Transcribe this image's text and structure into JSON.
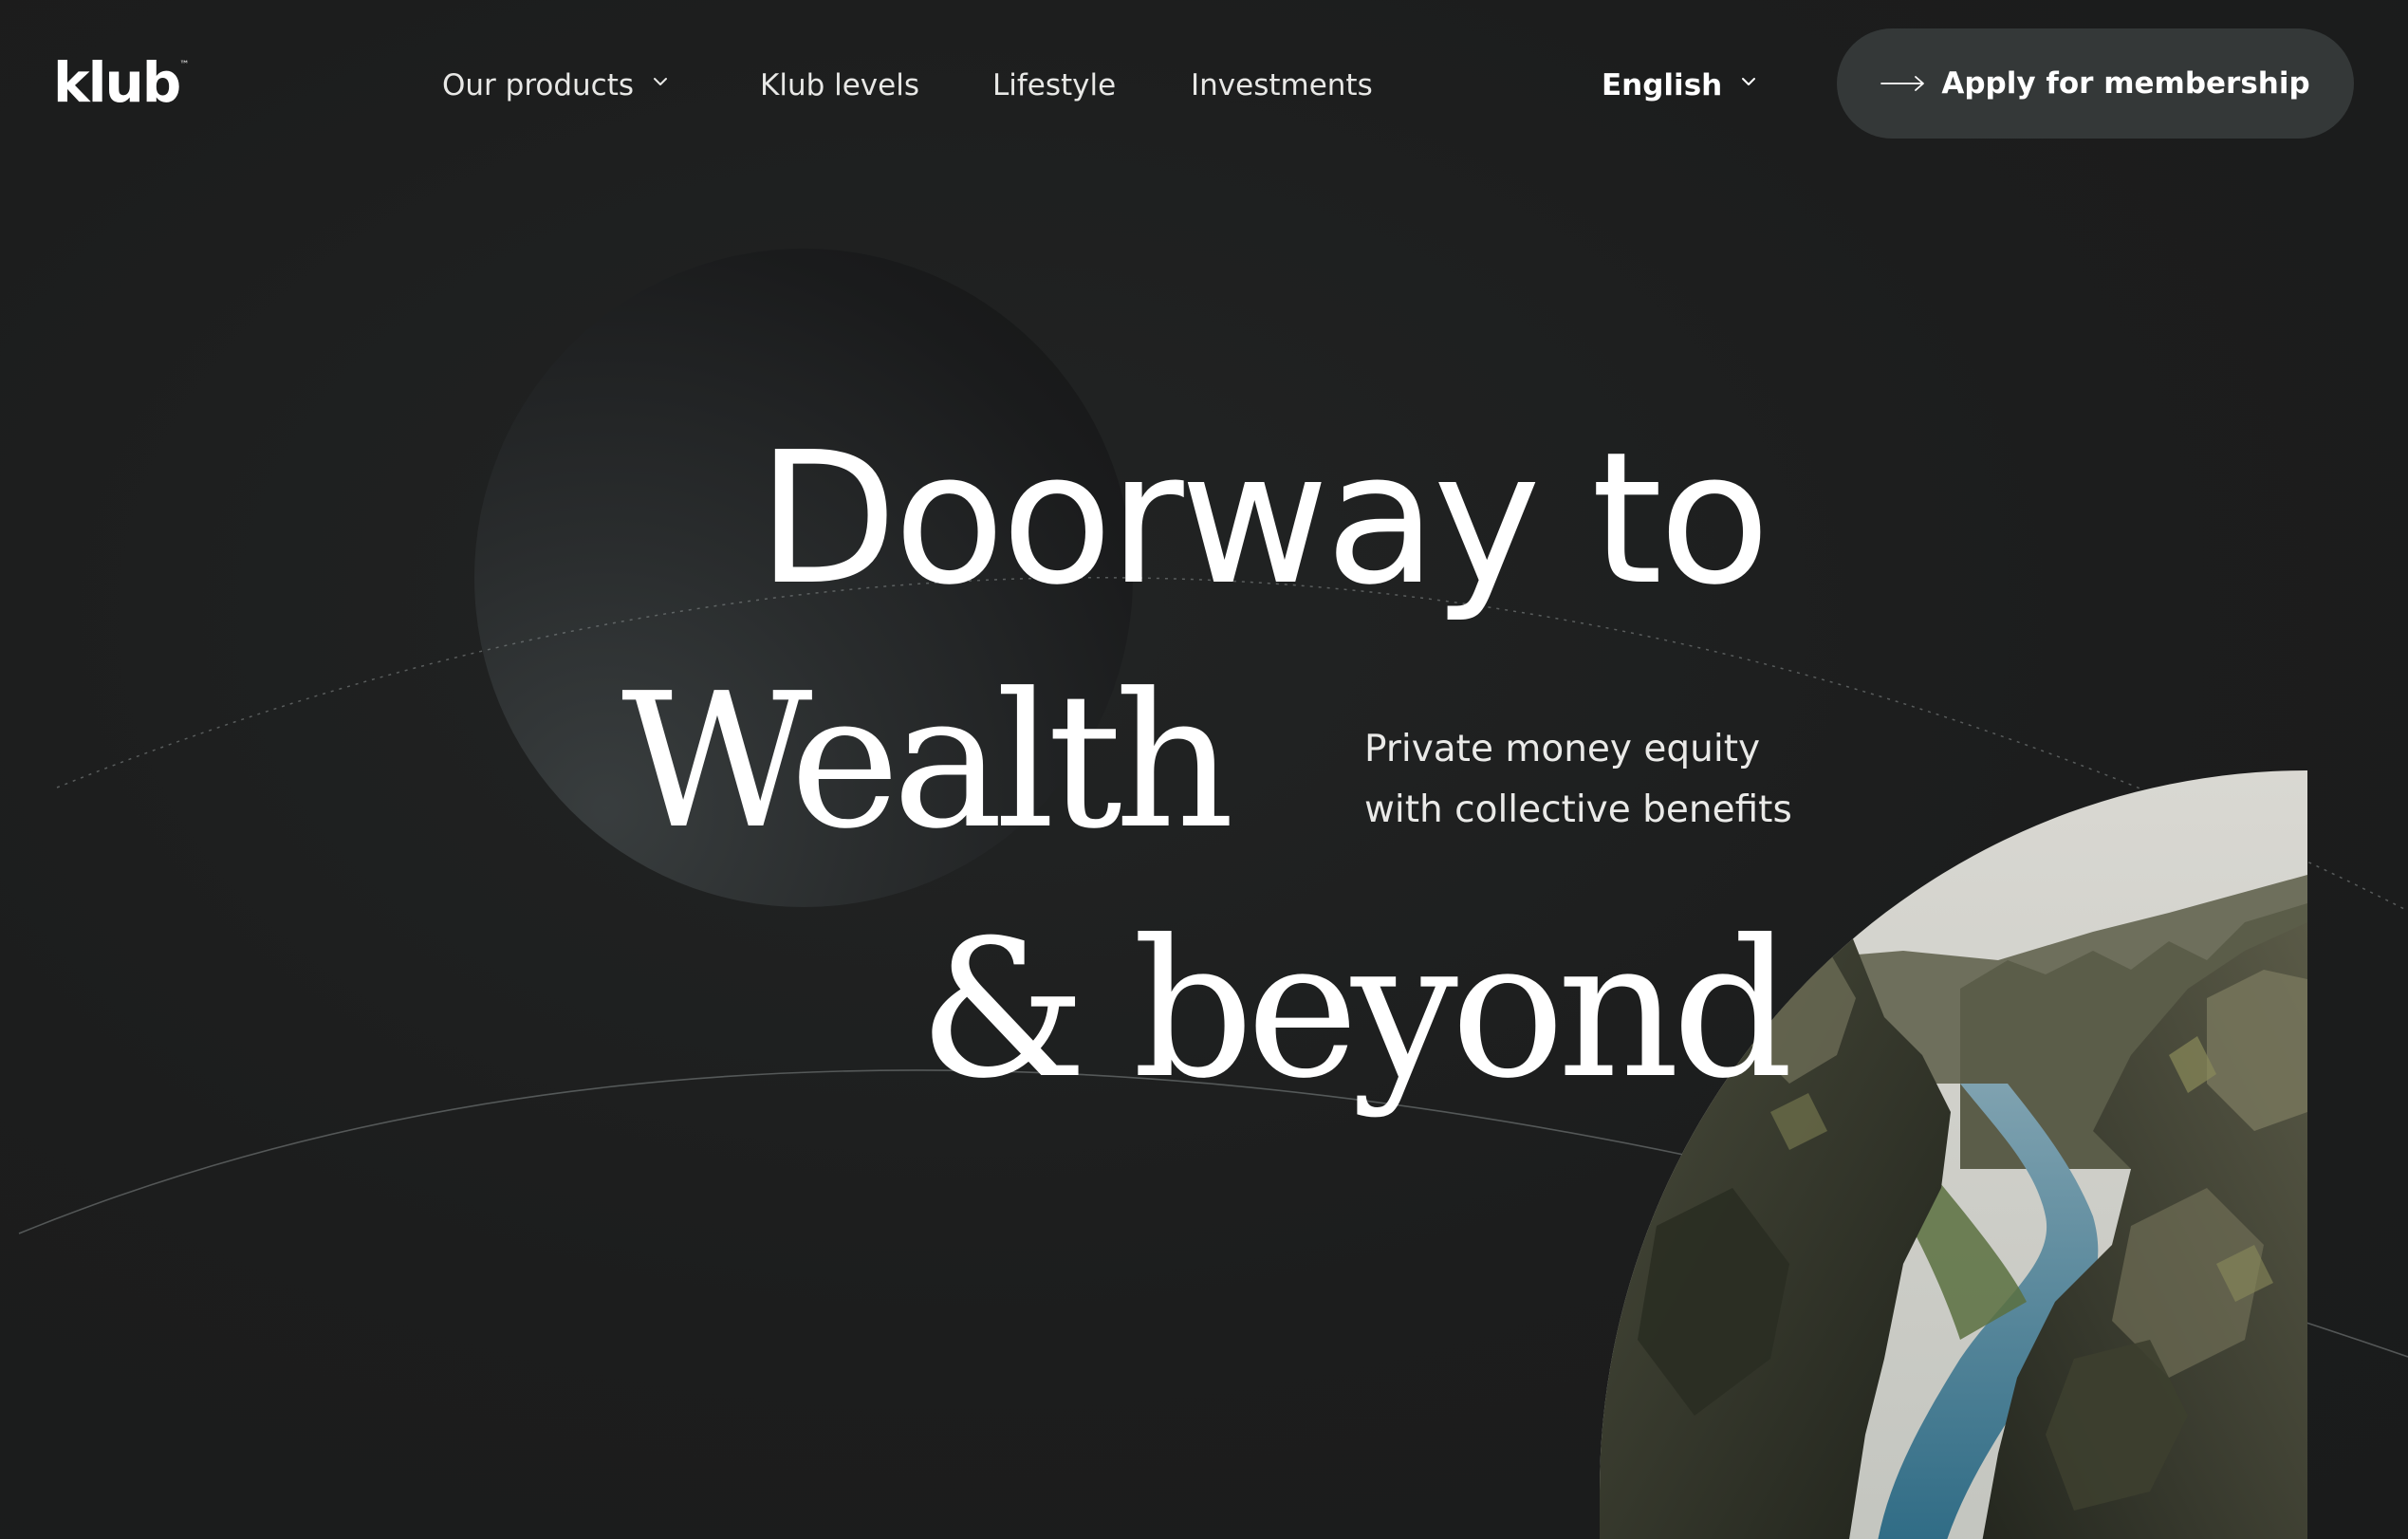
{
  "brand": {
    "logo_text": "klub",
    "trademark": "™"
  },
  "nav": {
    "items": [
      {
        "label": "Our products",
        "has_dropdown": true
      },
      {
        "label": "Klub levels",
        "has_dropdown": false
      },
      {
        "label": "Lifestyle",
        "has_dropdown": false
      },
      {
        "label": "Investments",
        "has_dropdown": false
      }
    ]
  },
  "language": {
    "selected": "English"
  },
  "cta": {
    "label": "Apply for membership",
    "icon": "arrow-right-icon"
  },
  "hero": {
    "line1": "Doorway to",
    "line2": "Wealth",
    "line3": "& beyond",
    "tagline_line1": "Private money equity",
    "tagline_line2": "with collective benefits"
  },
  "colors": {
    "background": "#1c1d1d",
    "button_bg": "#343838",
    "text": "#ffffff"
  },
  "image": {
    "subject": "canyon-landscape"
  }
}
